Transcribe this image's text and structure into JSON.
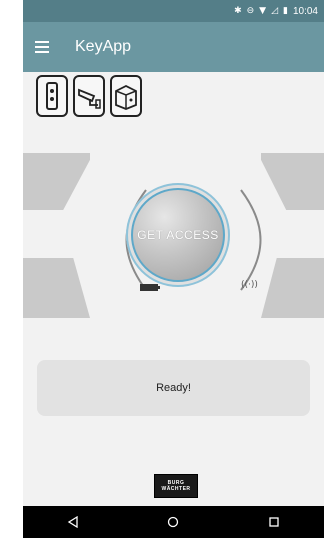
{
  "status_bar": {
    "time": "10:04",
    "icons": [
      "bluetooth-icon",
      "do-not-disturb-icon",
      "wifi-icon",
      "no-sim-icon",
      "battery-icon"
    ]
  },
  "toolbar": {
    "title": "KeyApp",
    "menu_icon": "hamburger-menu-icon"
  },
  "devices": [
    {
      "icon": "door-lock-device-icon"
    },
    {
      "icon": "camera-device-icon"
    },
    {
      "icon": "safe-box-device-icon"
    }
  ],
  "access": {
    "label": "GET ACCESS",
    "accent_color": "#5ea8c9"
  },
  "indicators": {
    "battery_icon": "battery-icon",
    "signal_label": "((·))"
  },
  "status": {
    "message": "Ready!"
  },
  "brand": {
    "line1": "BURG",
    "line2": "WÄCHTER"
  },
  "nav": {
    "back_icon": "back-triangle-icon",
    "home_icon": "home-circle-icon",
    "recents_icon": "recents-square-icon"
  },
  "colors": {
    "status_bar": "#547e88",
    "toolbar": "#6b97a1",
    "background": "#f2f2f2",
    "panel": "#e2e2e2"
  }
}
